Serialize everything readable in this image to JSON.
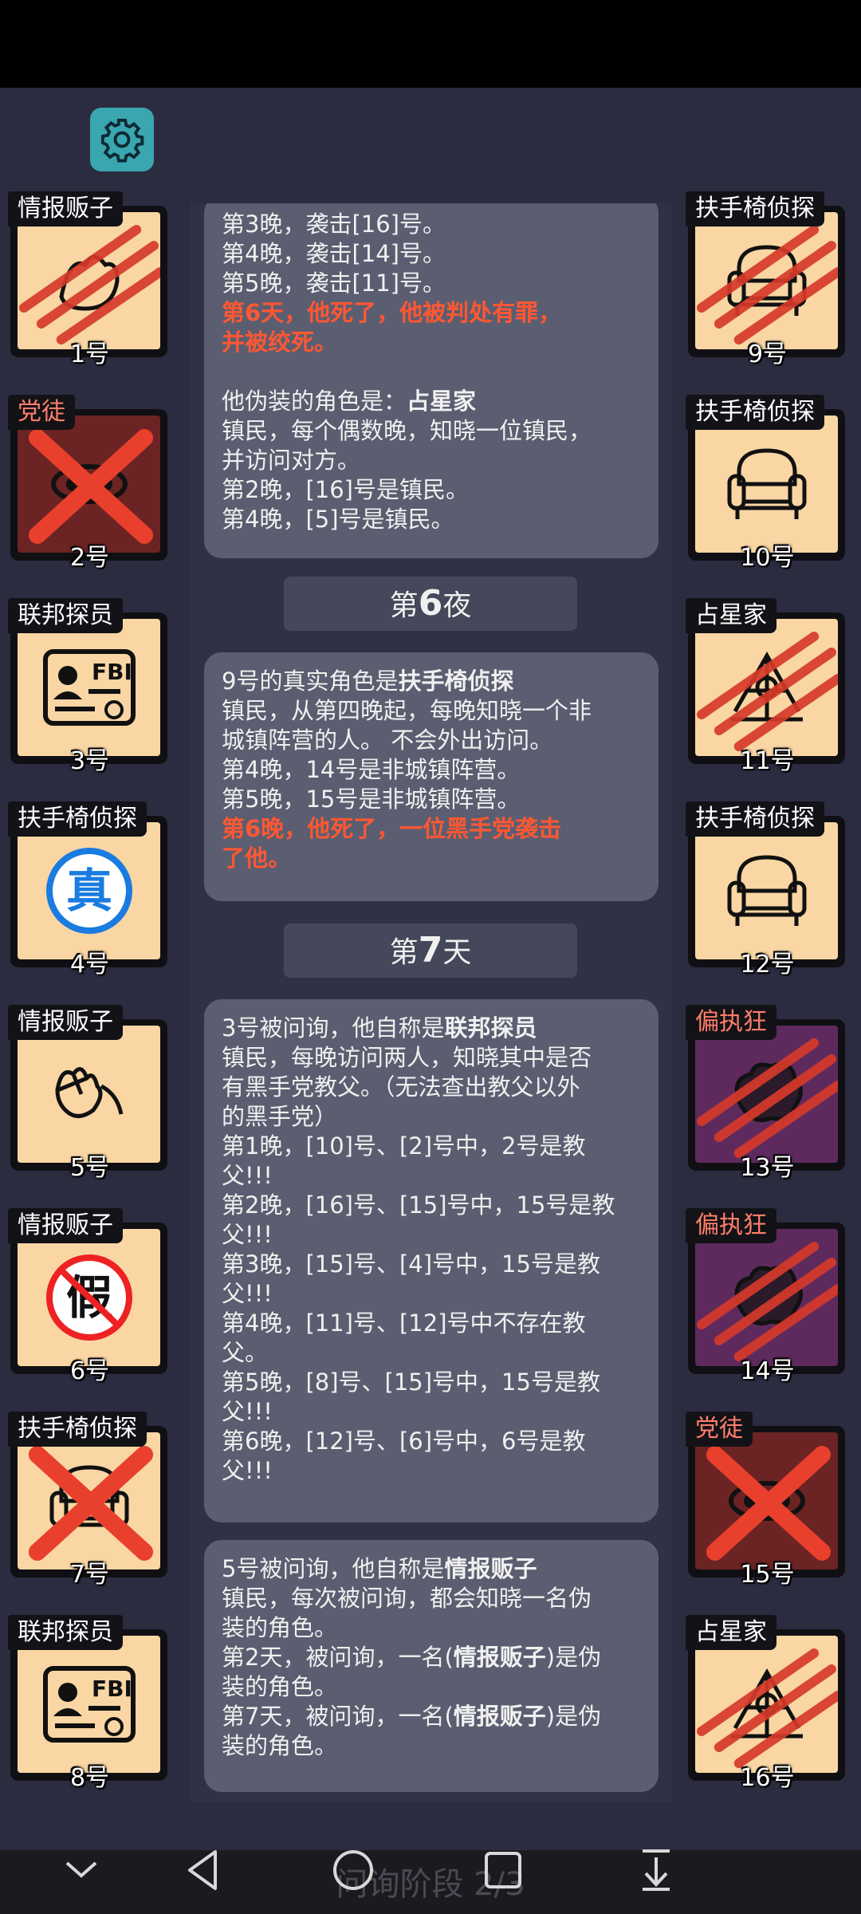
{
  "left_players": [
    {
      "role": "情报贩子",
      "num": "1号",
      "bg": "#f9d6a3",
      "state": "clawed",
      "icon": "hand-icon"
    },
    {
      "role": "党徒",
      "num": "2号",
      "bg": "#6b2323",
      "state": "crossed",
      "icon": "mask-icon",
      "role_color": "#ff7e6a"
    },
    {
      "role": "联邦探员",
      "num": "3号",
      "bg": "#f9d6a3",
      "state": "alive",
      "icon": "fbi-badge-icon"
    },
    {
      "role": "扶手椅侦探",
      "num": "4号",
      "bg": "#f9d6a3",
      "state": "true-stamp",
      "icon": "true-stamp-icon"
    },
    {
      "role": "情报贩子",
      "num": "5号",
      "bg": "#f9d6a3",
      "state": "alive",
      "icon": "whisper-hand-icon"
    },
    {
      "role": "情报贩子",
      "num": "6号",
      "bg": "#f9d6a3",
      "state": "fake-stamp",
      "icon": "fake-stamp-icon"
    },
    {
      "role": "扶手椅侦探",
      "num": "7号",
      "bg": "#f9d6a3",
      "state": "crossed",
      "icon": "armchair-icon"
    },
    {
      "role": "联邦探员",
      "num": "8号",
      "bg": "#f9d6a3",
      "state": "alive",
      "icon": "fbi-badge-icon"
    }
  ],
  "right_players": [
    {
      "role": "扶手椅侦探",
      "num": "9号",
      "bg": "#f9d6a3",
      "state": "clawed",
      "icon": "armchair-icon"
    },
    {
      "role": "扶手椅侦探",
      "num": "10号",
      "bg": "#f9d6a3",
      "state": "alive",
      "icon": "armchair-icon"
    },
    {
      "role": "占星家",
      "num": "11号",
      "bg": "#f9d6a3",
      "state": "clawed",
      "icon": "astrolabe-icon"
    },
    {
      "role": "扶手椅侦探",
      "num": "12号",
      "bg": "#f9d6a3",
      "state": "alive",
      "icon": "armchair-icon"
    },
    {
      "role": "偏执狂",
      "num": "13号",
      "bg": "#5e2a5e",
      "state": "clawed",
      "icon": "brain-icon",
      "role_color": "#ff7e6a"
    },
    {
      "role": "偏执狂",
      "num": "14号",
      "bg": "#5e2a5e",
      "state": "clawed",
      "icon": "brain-icon",
      "role_color": "#ff7e6a"
    },
    {
      "role": "党徒",
      "num": "15号",
      "bg": "#6b2323",
      "state": "crossed",
      "icon": "mask-icon",
      "role_color": "#ff7e6a"
    },
    {
      "role": "占星家",
      "num": "16号",
      "bg": "#f9d6a3",
      "state": "clawed",
      "icon": "astrolabe-icon"
    }
  ],
  "panel1": {
    "l1": "第3晚，袭击[16]号。",
    "l2": "第4晚，袭击[14]号。",
    "l3": "第5晚，袭击[11]号。",
    "red1": "第6天，他死了，他被判处有罪，",
    "red2": "并被绞死。",
    "disguise_prefix": "他伪装的角色是：",
    "disguise_role": "占星家",
    "d1": "镇民，每个偶数晚，知晓一位镇民，",
    "d2": "并访问对方。",
    "d3": "第2晚，[16]号是镇民。",
    "d4": "第4晚，[5]号是镇民。"
  },
  "section_night": {
    "prefix": "第",
    "num": "6",
    "suffix": "夜"
  },
  "panel2": {
    "prefix": "9号的真实角色是",
    "role": "扶手椅侦探",
    "l1": "镇民，从第四晚起，每晚知晓一个非",
    "l2": "城镇阵营的人。 不会外出访问。",
    "l3": "第4晚，14号是非城镇阵营。",
    "l4": "第5晚，15号是非城镇阵营。",
    "red1": "第6晚，他死了，一位黑手党袭击",
    "red2": "了他。"
  },
  "section_day": {
    "prefix": "第",
    "num": "7",
    "suffix": "天"
  },
  "panel3": {
    "prefix": "3号被问询，他自称是",
    "role": "联邦探员",
    "lines": [
      "镇民，每晚访问两人，知晓其中是否",
      "有黑手党教父。（无法查出教父以外",
      "的黑手党）",
      "第1晚，[10]号、[2]号中，2号是教",
      "父!!!",
      "第2晚，[16]号、[15]号中，15号是教",
      "父!!!",
      "第3晚，[15]号、[4]号中，15号是教",
      "父!!!",
      "第4晚，[11]号、[12]号中不存在教",
      "父。",
      "第5晚，[8]号、[15]号中，15号是教",
      "父!!!",
      "第6晚，[12]号、[6]号中，6号是教",
      "父!!!"
    ]
  },
  "panel4": {
    "prefix": "5号被问询，他自称是",
    "role": "情报贩子",
    "l1": "镇民，每次被问询，都会知晓一名伪",
    "l2": "装的角色。",
    "l3a": "第2天，被问询，一名(",
    "l3b": "情报贩子",
    "l3c": ")是伪",
    "l4": "装的角色。",
    "l5a": "第7天，被问询，一名(",
    "l5b": "情报贩子",
    "l5c": ")是伪",
    "l6": "装的角色。"
  },
  "bottom": {
    "phase": "问询阶段 2/3"
  }
}
